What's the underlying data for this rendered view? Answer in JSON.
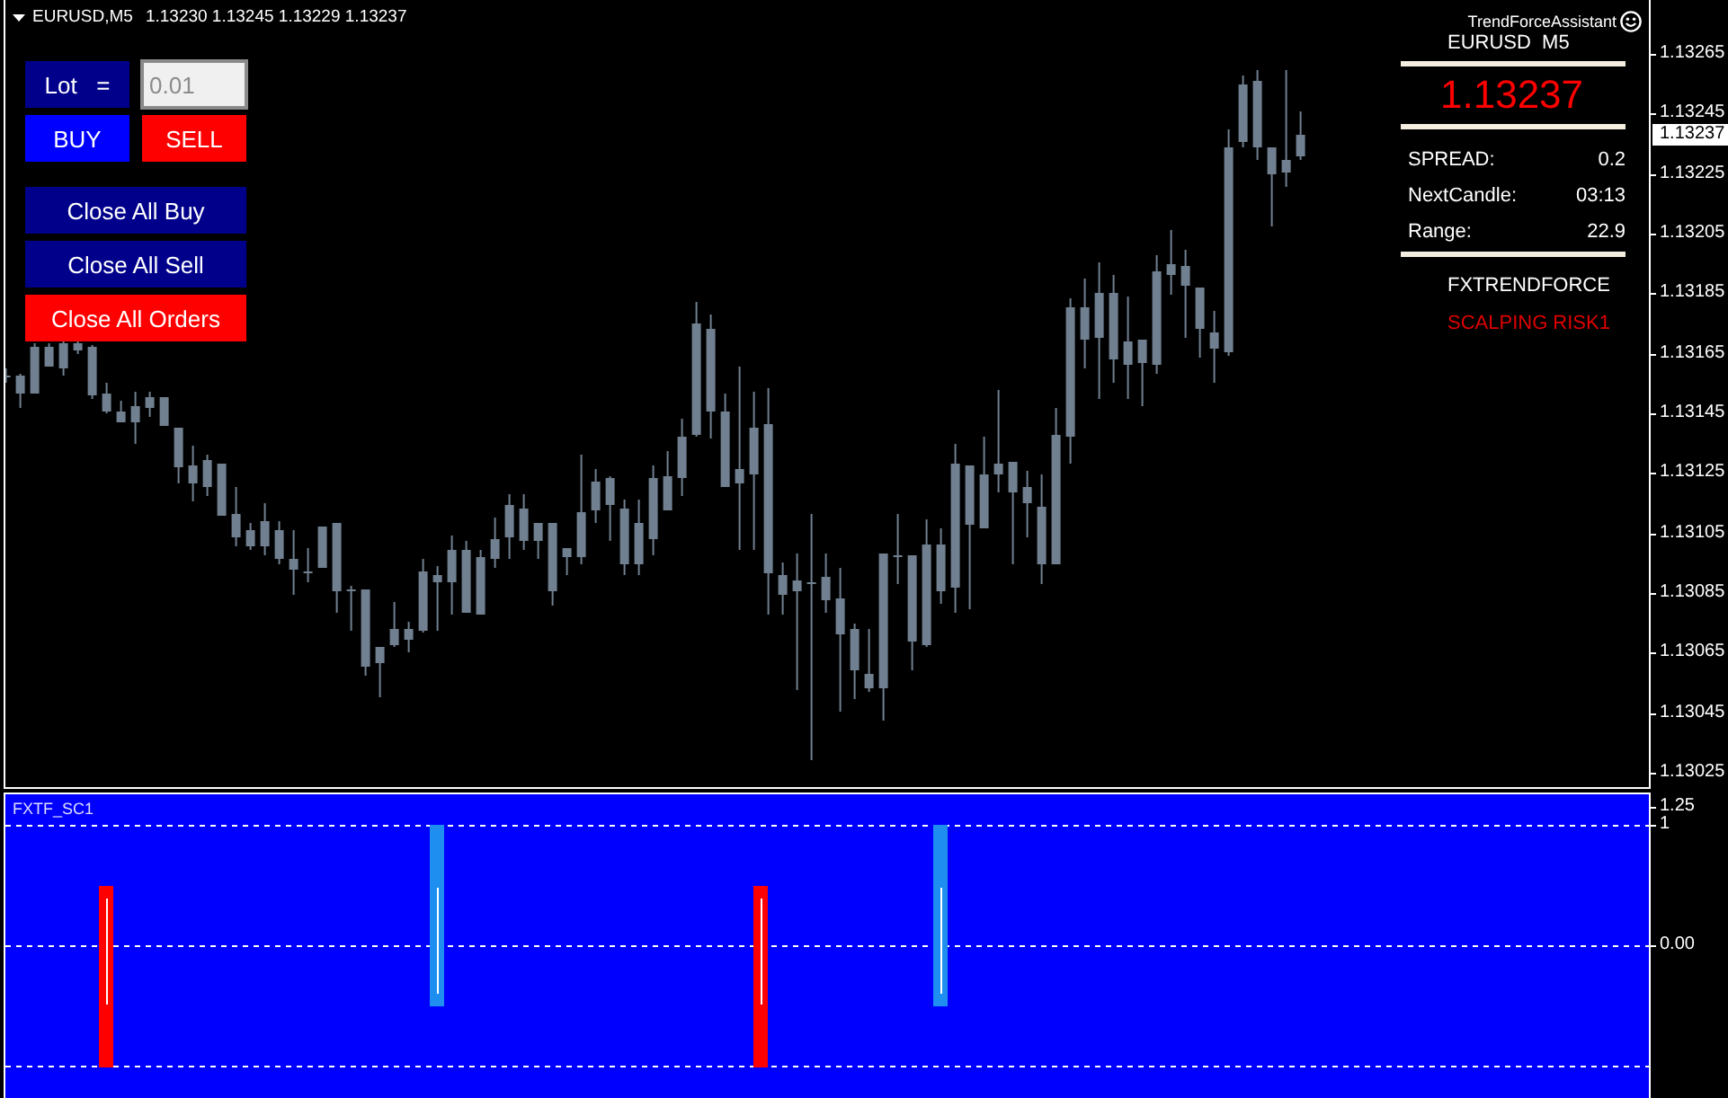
{
  "chart_header": {
    "symbol": "EURUSD,M5",
    "quotes": [
      "1.13230",
      "1.13245",
      "1.13229",
      "1.13237"
    ]
  },
  "trade_panel": {
    "lot_label": "Lot   =",
    "lot_field": {
      "value": "0.01"
    },
    "buttons": [
      {
        "label": "BUY",
        "kind": "buy"
      },
      {
        "label": "SELL",
        "kind": "sell"
      },
      {
        "label": "Close All Buy",
        "kind": "close"
      },
      {
        "label": "Close All Sell",
        "kind": "close"
      },
      {
        "label": "Close All Orders",
        "kind": "close_all"
      }
    ]
  },
  "info_panel": {
    "title": "TrendForceAssistant",
    "symbol": "EURUSD  M5",
    "price": "1.13237",
    "stats": [
      {
        "label": "SPREAD:",
        "value": "0.2"
      },
      {
        "label": "NextCandle:",
        "value": "03:13"
      },
      {
        "label": "Range:",
        "value": "22.9"
      }
    ],
    "brand": "FXTRENDFORCE",
    "mode": "SCALPING RISK1"
  },
  "price_axis": {
    "labels": [
      "1.13265",
      "1.13245",
      "1.13225",
      "1.13205",
      "1.13185",
      "1.13165",
      "1.13145",
      "1.13125",
      "1.13105",
      "1.13085",
      "1.13065",
      "1.13045",
      "1.13025"
    ],
    "current_price": "1.13237"
  },
  "indicator": {
    "name": "FXTF_SC1",
    "axis_labels": [
      "1.25",
      "1",
      "0.00"
    ]
  }
}
